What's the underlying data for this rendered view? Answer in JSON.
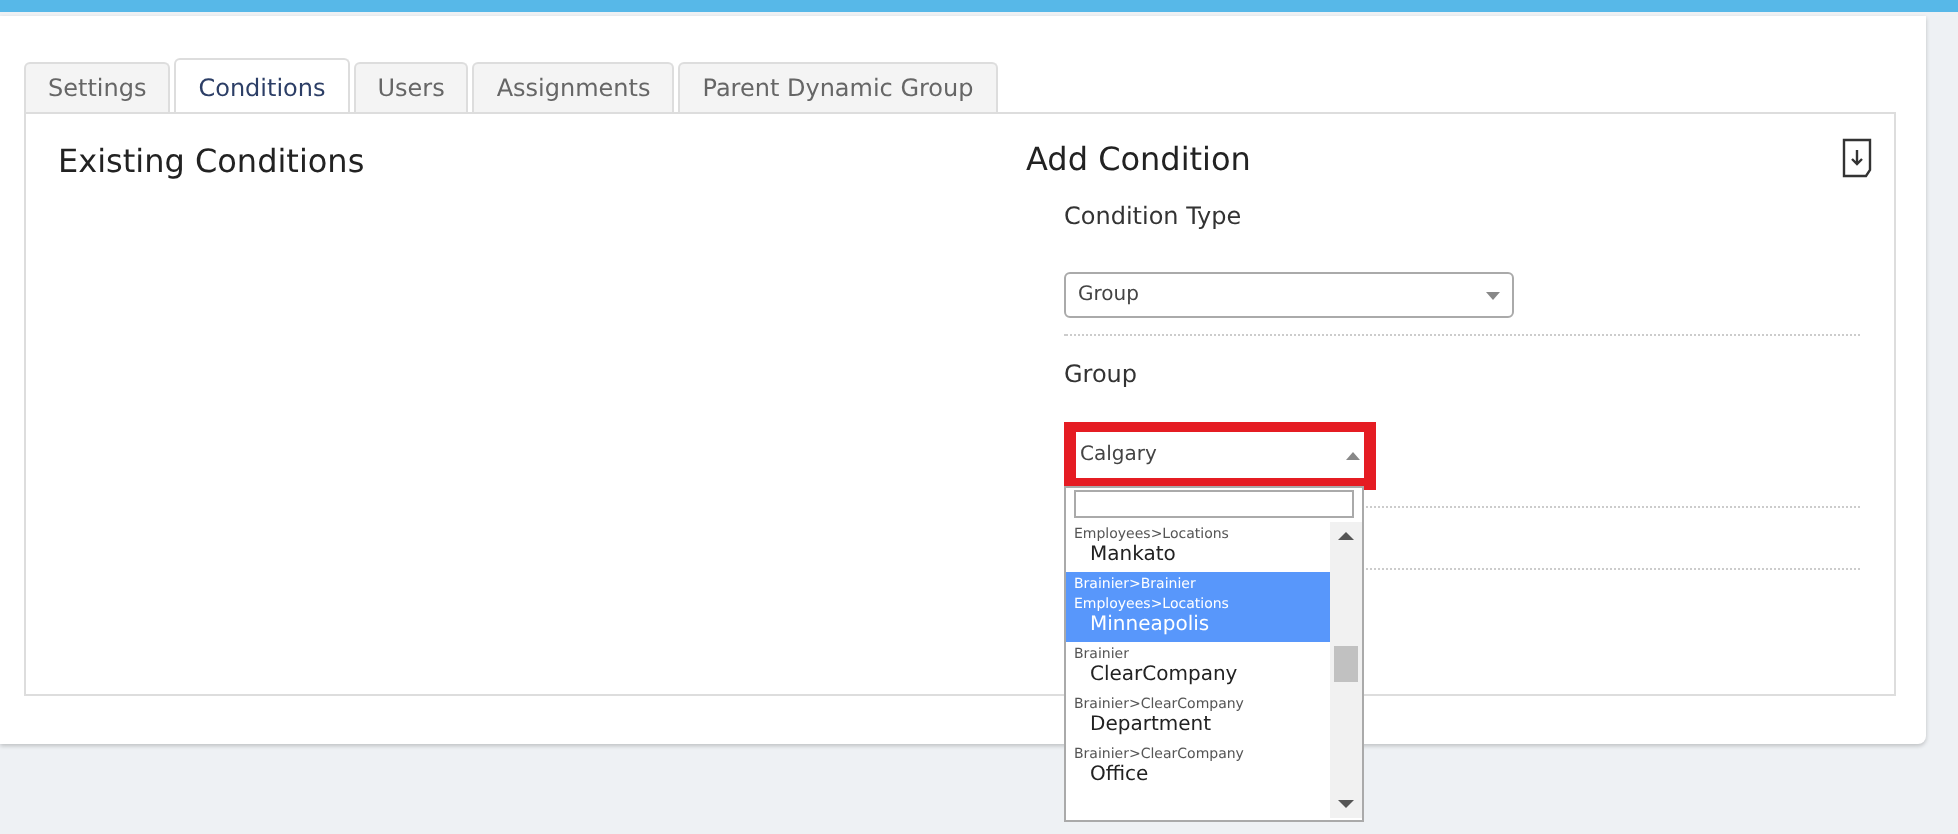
{
  "tabs": [
    {
      "label": "Settings",
      "selected": false
    },
    {
      "label": "Conditions",
      "selected": true
    },
    {
      "label": "Users",
      "selected": false
    },
    {
      "label": "Assignments",
      "selected": false
    },
    {
      "label": "Parent Dynamic Group",
      "selected": false
    }
  ],
  "existing_conditions": {
    "title": "Existing Conditions"
  },
  "add_condition": {
    "title": "Add Condition",
    "condition_type": {
      "label": "Condition Type",
      "value": "Group"
    },
    "group": {
      "label": "Group",
      "value": "Calgary",
      "highlighted": true
    }
  },
  "group_dropdown": {
    "options": [
      {
        "path": [
          "Employees>Locations"
        ],
        "name": "Mankato",
        "selected": false
      },
      {
        "path": [
          "Brainier>Brainier",
          "Employees>Locations"
        ],
        "name": "Minneapolis",
        "selected": true
      },
      {
        "path": [
          "Brainier"
        ],
        "name": "ClearCompany",
        "selected": false
      },
      {
        "path": [
          "Brainier>ClearCompany"
        ],
        "name": "Department",
        "selected": false
      },
      {
        "path": [
          "Brainier>ClearCompany"
        ],
        "name": "Office",
        "selected": false
      }
    ]
  }
}
